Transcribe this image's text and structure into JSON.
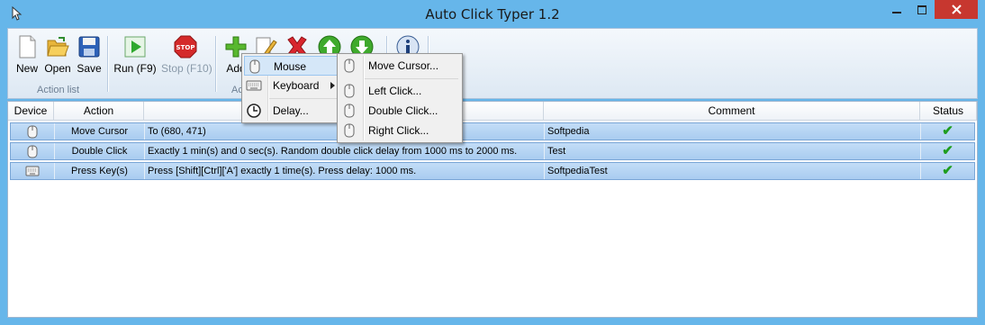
{
  "window": {
    "title": "Auto Click Typer 1.2"
  },
  "ribbon": {
    "new_label": "New",
    "open_label": "Open",
    "save_label": "Save",
    "action_list_group": "Action list",
    "run_label": "Run (F9)",
    "stop_label": "Stop (F10)",
    "add_label": "Add",
    "actions_group": "Ac"
  },
  "table": {
    "columns": [
      "Device",
      "Action",
      "",
      "Comment",
      "Status"
    ],
    "rows": [
      {
        "action": "Move Cursor",
        "details": "To (680, 471)",
        "comment": "Softpedia"
      },
      {
        "action": "Double Click",
        "details": "Exactly 1 min(s) and 0 sec(s). Random double click delay from 1000 ms to 2000 ms.",
        "comment": "Test"
      },
      {
        "action": "Press Key(s)",
        "details": "Press [Shift][Ctrl]['A'] exactly 1 time(s). Press delay: 1000 ms.",
        "comment": "SoftpediaTest"
      }
    ]
  },
  "add_menu": {
    "items": [
      "Mouse",
      "Keyboard",
      "Delay..."
    ]
  },
  "mouse_submenu": {
    "items": [
      "Move Cursor...",
      "Left Click...",
      "Double Click...",
      "Right Click..."
    ]
  },
  "colors": {
    "titlebar": "#66b6ea",
    "close": "#c7372f",
    "row_selected": "#b6d5f3",
    "check": "#1f9d1f"
  },
  "icons": {
    "app": "mouse-cursor-icon",
    "new": "new-document-icon",
    "open": "folder-open-icon",
    "save": "floppy-disk-icon",
    "run": "play-icon",
    "stop": "stop-sign-icon",
    "add": "plus-icon",
    "edit": "edit-icon",
    "delete": "delete-x-icon",
    "up": "arrow-up-icon",
    "down": "arrow-down-icon",
    "about": "info-icon"
  }
}
